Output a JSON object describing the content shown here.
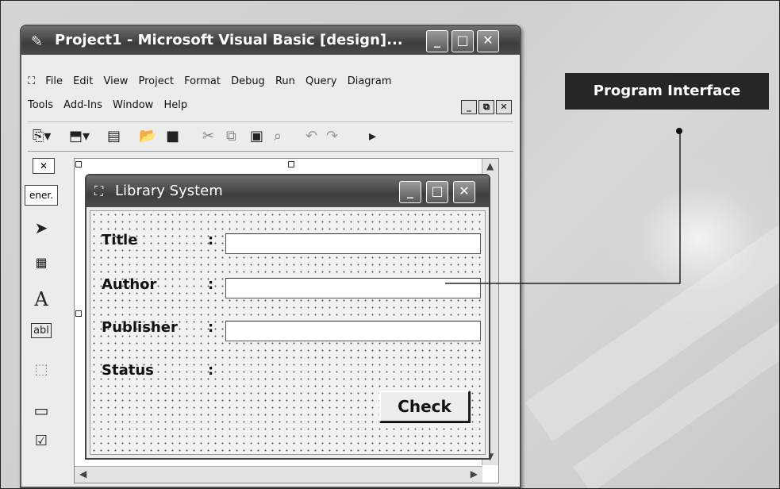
{
  "window": {
    "title": "Project1 - Microsoft Visual Basic [design]...",
    "buttons": {
      "minimize": "_",
      "maximize": "□",
      "close": "✕"
    }
  },
  "menubar": {
    "row1": [
      "File",
      "Edit",
      "View",
      "Project",
      "Format",
      "Debug",
      "Run",
      "Query",
      "Diagram"
    ],
    "row2": [
      "Tools",
      "Add-Ins",
      "Window",
      "Help"
    ]
  },
  "toolbox": {
    "tab_label": "ener.",
    "close": "✕",
    "items": [
      "pointer-icon",
      "picturebox-icon",
      "label-icon",
      "textbox-icon",
      "frame-icon",
      "commandbutton-icon",
      "checkbox-icon"
    ]
  },
  "form": {
    "title": "Library System",
    "fields": [
      {
        "label": "Title",
        "colon": ":"
      },
      {
        "label": "Author",
        "colon": ":"
      },
      {
        "label": "Publisher",
        "colon": ":"
      },
      {
        "label": "Status",
        "colon": ":"
      }
    ],
    "check_button": "Check"
  },
  "callout": {
    "label": "Program Interface"
  }
}
